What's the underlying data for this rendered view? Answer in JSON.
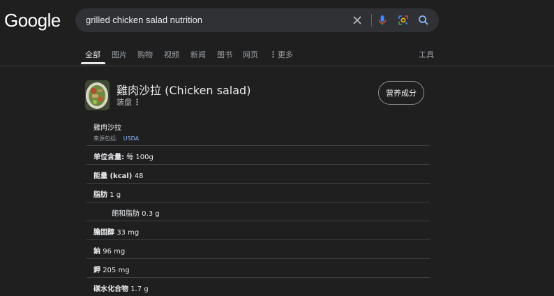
{
  "logo": "Google",
  "search": {
    "query": "grilled chicken salad nutrition"
  },
  "icons": [
    "clear-icon",
    "microphone-icon",
    "lens-icon",
    "search-icon",
    "more-icon",
    "kebab-icon"
  ],
  "tabs": [
    {
      "label": "全部",
      "active": true
    },
    {
      "label": "图片"
    },
    {
      "label": "购物"
    },
    {
      "label": "视频"
    },
    {
      "label": "新闻"
    },
    {
      "label": "图书"
    },
    {
      "label": "网页"
    },
    {
      "label": "更多"
    }
  ],
  "tools_label": "工具",
  "food": {
    "title": "雞肉沙拉 (Chicken salad)",
    "subtitle": "装盘",
    "nutrition_button": "营养成分"
  },
  "source": {
    "name": "雞肉沙拉",
    "prefix": "来源包括:",
    "link": "USDA"
  },
  "nutrition": [
    {
      "label": "单位含量:",
      "value": "每 100g",
      "sub": false
    },
    {
      "label": "能量 (kcal)",
      "value": "48",
      "sub": false
    },
    {
      "label": "脂肪",
      "value": "1 g",
      "sub": false
    },
    {
      "label": "",
      "value": "飽和脂肪 0.3 g",
      "sub": true
    },
    {
      "label": "膽固醇",
      "value": "33 mg",
      "sub": false
    },
    {
      "label": "鈉",
      "value": "96 mg",
      "sub": false
    },
    {
      "label": "鉀",
      "value": "205 mg",
      "sub": false
    },
    {
      "label": "碳水化合物",
      "value": "1.7 g",
      "sub": false
    }
  ],
  "colors": {
    "background": "#1f1f1f",
    "searchbox": "#303134",
    "link": "#8ab4f8",
    "divider": "#3c4043"
  }
}
